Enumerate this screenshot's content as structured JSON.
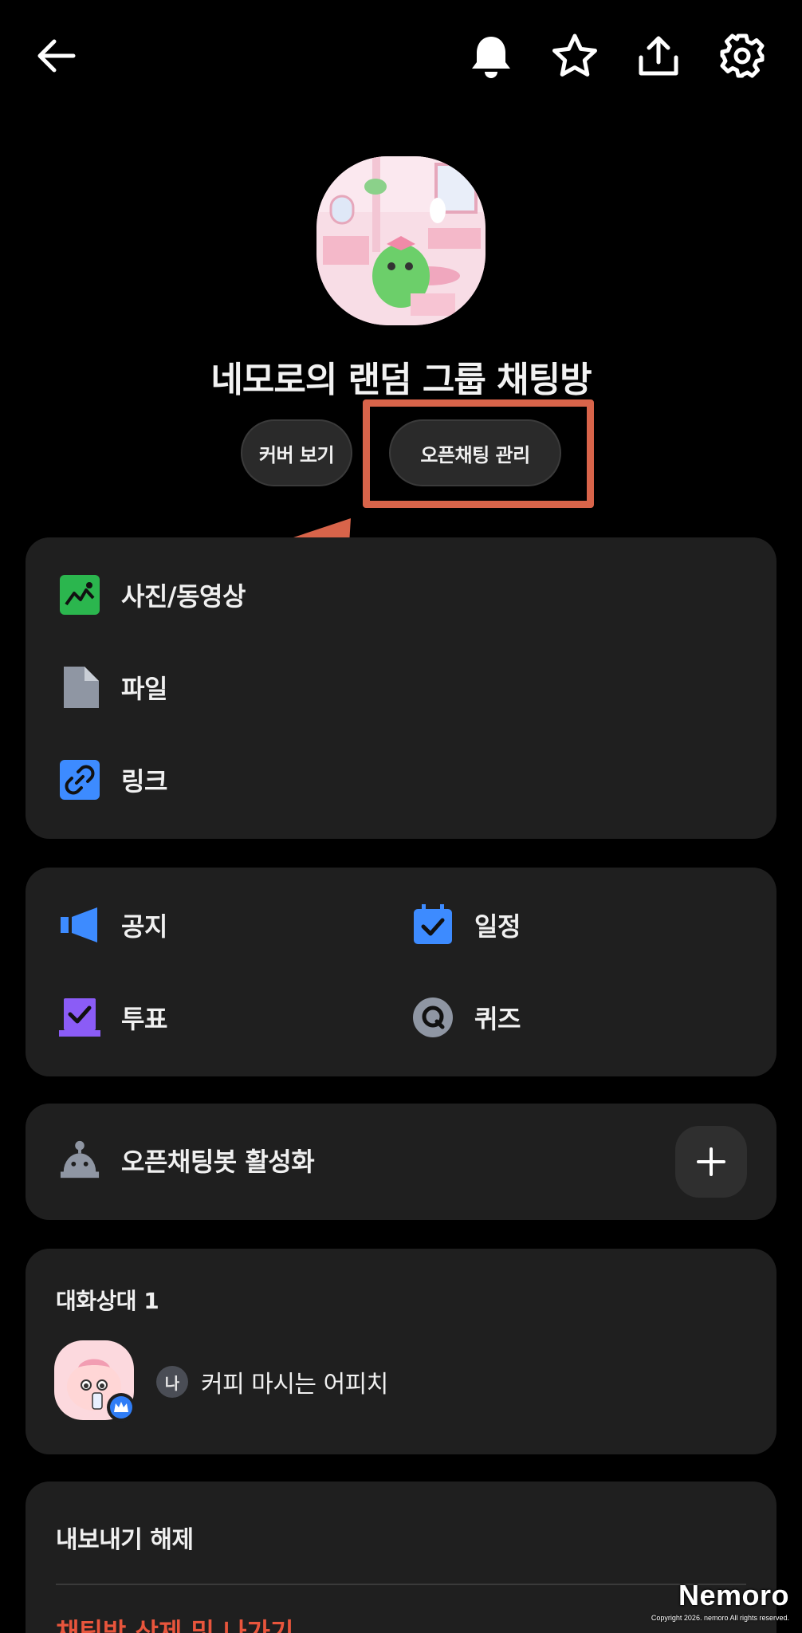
{
  "header": {
    "back_icon": "arrow-left-icon",
    "actions": [
      "bell-icon",
      "star-icon",
      "share-icon",
      "gear-icon"
    ]
  },
  "room": {
    "title": "네모로의 랜덤 그룹 채팅방",
    "buttons": {
      "view_cover": "커버 보기",
      "manage_openchat": "오픈채팅 관리"
    }
  },
  "media_card": {
    "items": [
      {
        "label": "사진/동영상",
        "icon": "photo-icon",
        "color": "#2bb64e"
      },
      {
        "label": "파일",
        "icon": "file-icon",
        "color": "#8f96a3"
      },
      {
        "label": "링크",
        "icon": "link-icon",
        "color": "#3d8bff"
      }
    ]
  },
  "tools_card": {
    "items": [
      {
        "label": "공지",
        "icon": "megaphone-icon",
        "color": "#3d8bff"
      },
      {
        "label": "일정",
        "icon": "calendar-icon",
        "color": "#3d8bff"
      },
      {
        "label": "투표",
        "icon": "vote-icon",
        "color": "#8b5cf6"
      },
      {
        "label": "퀴즈",
        "icon": "quiz-icon",
        "color": "#8f96a3"
      }
    ]
  },
  "bot_card": {
    "label": "오픈채팅봇 활성화",
    "icon": "bot-icon"
  },
  "members": {
    "title": "대화상대 1",
    "me_badge": "나",
    "member_name": "커피 마시는 어피치"
  },
  "export_card": {
    "title": "내보내기 해제",
    "danger_label": "채팅방 삭제 및 나가기",
    "danger_color": "#e8553c"
  },
  "accent": {
    "highlight": "#d8644a"
  },
  "watermark": {
    "name": "Nemoro",
    "copyright": "Copyright 2026. nemoro All rights reserved."
  }
}
